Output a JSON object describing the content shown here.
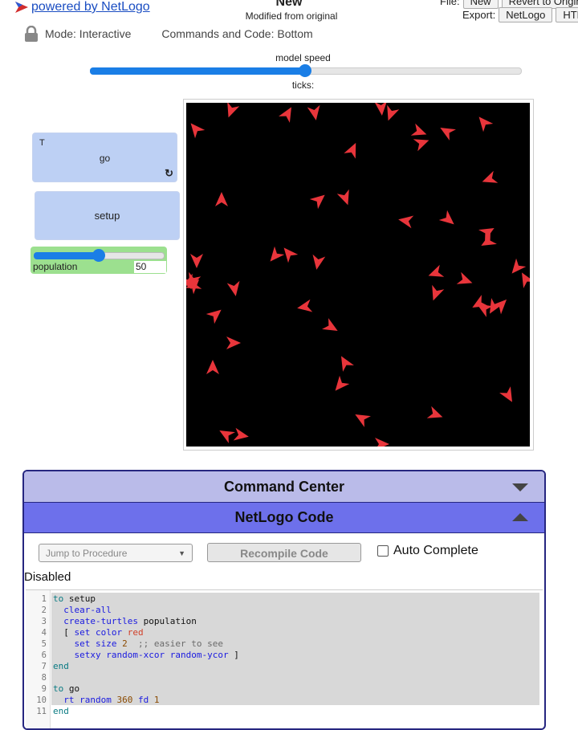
{
  "header": {
    "logo_text": " powered by NetLogo",
    "title": "New",
    "subtitle": "Modified from original",
    "file_label": "File:",
    "file_buttons": [
      "New",
      "Revert to Original"
    ],
    "export_label": "Export:",
    "export_buttons": [
      "NetLogo",
      "HTML"
    ]
  },
  "modes": {
    "mode_text": "Mode: Interactive",
    "commands_text": "Commands and Code: Bottom"
  },
  "speed": {
    "label": "model speed",
    "value": 0.5,
    "ticks_label": "ticks:"
  },
  "widgets": {
    "go": {
      "forever_indicator": "T",
      "label": "go"
    },
    "setup": {
      "label": "setup"
    },
    "population": {
      "label": "population",
      "value": "50",
      "fraction": 0.5
    }
  },
  "world": {
    "background": "#000000",
    "turtle_color": "#e8353b",
    "turtles": [
      [
        56,
        9,
        200
      ],
      [
        126,
        14,
        30
      ],
      [
        160,
        12,
        170
      ],
      [
        255,
        13,
        200
      ],
      [
        243,
        6,
        175
      ],
      [
        290,
        36,
        110
      ],
      [
        293,
        50,
        70
      ],
      [
        325,
        36,
        300
      ],
      [
        371,
        25,
        320
      ],
      [
        207,
        59,
        25
      ],
      [
        378,
        95,
        250
      ],
      [
        12,
        33,
        320
      ],
      [
        44,
        121,
        0
      ],
      [
        198,
        118,
        160
      ],
      [
        165,
        121,
        50
      ],
      [
        274,
        147,
        280
      ],
      [
        326,
        145,
        130
      ],
      [
        375,
        161,
        60
      ],
      [
        376,
        173,
        240
      ],
      [
        13,
        196,
        180
      ],
      [
        111,
        190,
        220
      ],
      [
        128,
        188,
        320
      ],
      [
        164,
        198,
        190
      ],
      [
        311,
        212,
        250
      ],
      [
        347,
        221,
        110
      ],
      [
        412,
        205,
        220
      ],
      [
        423,
        220,
        330
      ],
      [
        9,
        227,
        250
      ],
      [
        60,
        231,
        170
      ],
      [
        311,
        237,
        200
      ],
      [
        148,
        254,
        260
      ],
      [
        36,
        264,
        50
      ],
      [
        180,
        279,
        120
      ],
      [
        365,
        250,
        240
      ],
      [
        392,
        252,
        45
      ],
      [
        198,
        324,
        330
      ],
      [
        192,
        351,
        220
      ],
      [
        58,
        299,
        90
      ],
      [
        33,
        330,
        0
      ],
      [
        401,
        364,
        150
      ],
      [
        219,
        393,
        300
      ],
      [
        310,
        388,
        110
      ],
      [
        3,
        223,
        160
      ],
      [
        371,
        256,
        300
      ],
      [
        50,
        413,
        300
      ],
      [
        68,
        414,
        100
      ],
      [
        243,
        425,
        90
      ],
      [
        9,
        227,
        45
      ],
      [
        8,
        221,
        200
      ],
      [
        383,
        254,
        210
      ]
    ]
  },
  "command_center": {
    "title": "Command Center"
  },
  "code_panel": {
    "title": "NetLogo Code",
    "jump_placeholder": "Jump to Procedure",
    "recompile_label": "Recompile Code",
    "auto_complete_label": "Auto Complete",
    "status": "Disabled"
  },
  "code_lines": [
    "to setup",
    "  clear-all",
    "  create-turtles population",
    "  [ set color red",
    "    set size 2  ;; easier to see",
    "    setxy random-xcor random-ycor ]",
    "end",
    "",
    "to go",
    "  rt random 360 fd 1",
    "end"
  ]
}
